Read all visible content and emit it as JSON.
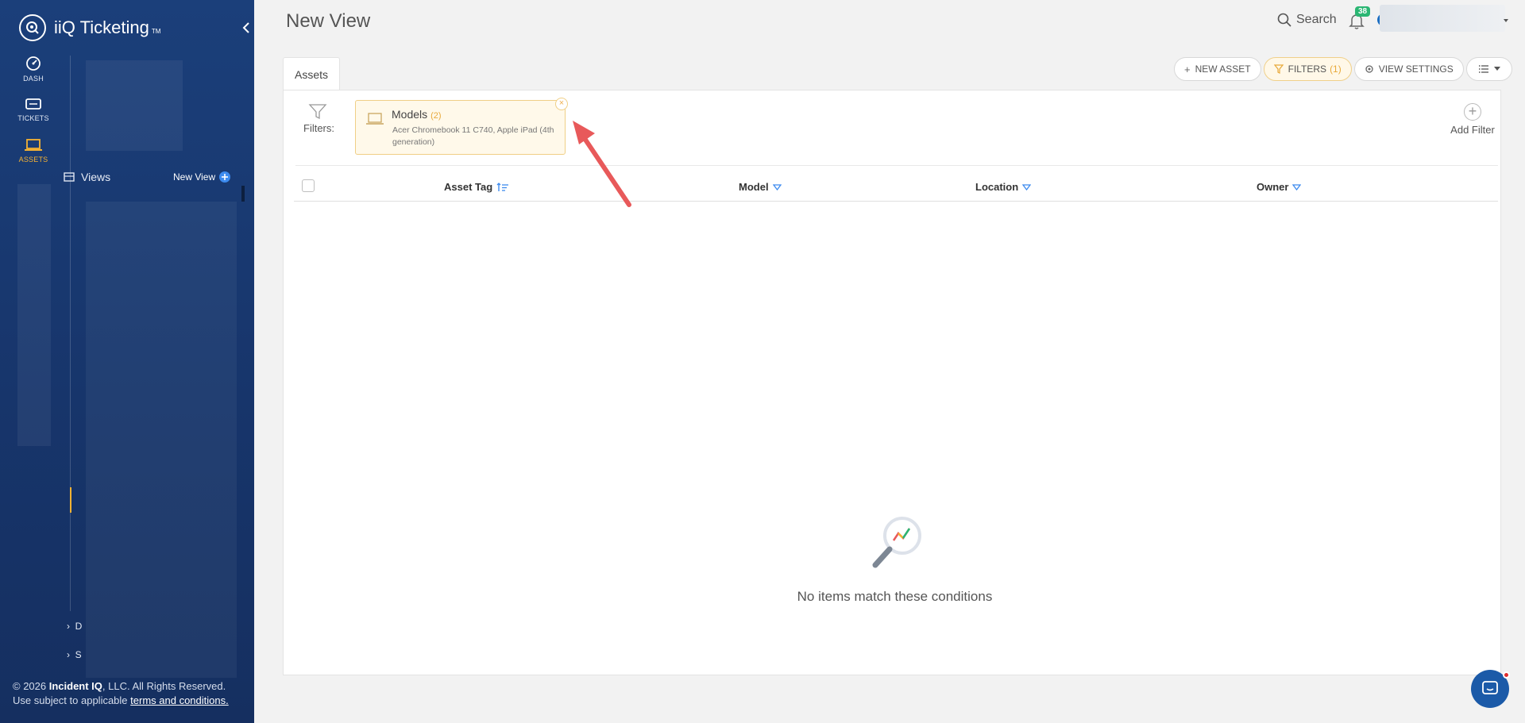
{
  "app": {
    "name": "iiQ Ticketing",
    "trademark": "TM"
  },
  "rail": [
    {
      "label": "DASH",
      "icon": "dashboard-icon"
    },
    {
      "label": "TICKETS",
      "icon": "ticket-icon"
    },
    {
      "label": "ASSETS",
      "icon": "laptop-icon",
      "active": true
    }
  ],
  "sidebar": {
    "views_label": "Views",
    "new_view_label": "New View",
    "tree_items": [
      "D",
      "S"
    ]
  },
  "footer": {
    "copyright_prefix": "© 2026 ",
    "company": "Incident IQ",
    "copyright_suffix": ", LLC. All Rights Reserved.",
    "line2_prefix": "Use subject to applicable ",
    "terms_link": "terms and conditions."
  },
  "header": {
    "title": "New View",
    "search_label": "Search",
    "notification_count": "38"
  },
  "tabs": [
    {
      "label": "Assets"
    }
  ],
  "toolbar": {
    "new_asset": "NEW ASSET",
    "filters": "FILTERS",
    "filters_count": "(1)",
    "view_settings": "VIEW SETTINGS"
  },
  "filters": {
    "label": "Filters:",
    "add_filter": "Add Filter",
    "cards": [
      {
        "title": "Models",
        "count": "(2)",
        "description": "Acer Chromebook 11 C740, Apple iPad (4th generation)",
        "icon": "laptop-icon"
      }
    ]
  },
  "table": {
    "columns": [
      "Asset Tag",
      "Model",
      "Location",
      "Owner"
    ]
  },
  "empty_state": {
    "message": "No items match these conditions",
    "icon": "magnifier-chart-icon"
  },
  "colors": {
    "sidebar_bg": "#17356b",
    "accent_orange": "#f5b233",
    "badge_green": "#2bb673",
    "link_blue": "#3d8bef",
    "annotation_red": "#e8595a"
  }
}
